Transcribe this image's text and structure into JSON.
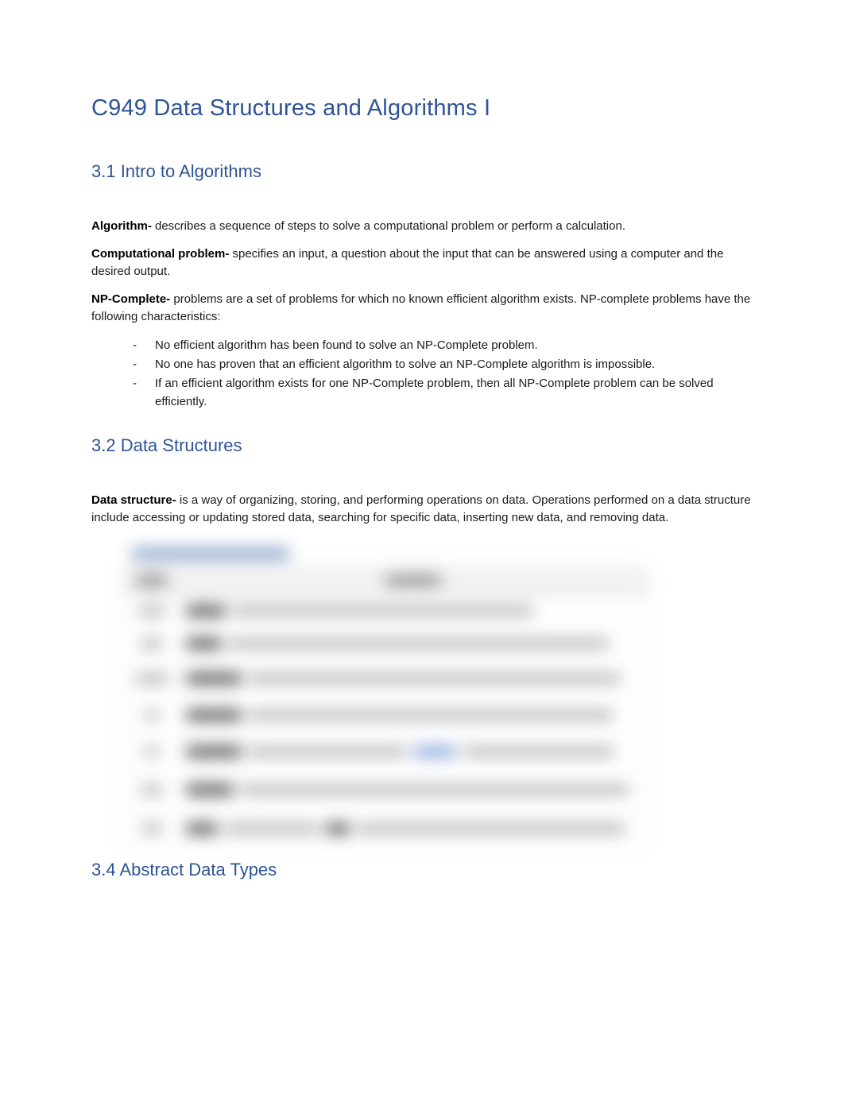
{
  "title": "C949 Data Structures and Algorithms I",
  "sections": {
    "s31": {
      "heading": "3.1 Intro to Algorithms",
      "p1_term": "Algorithm- ",
      "p1_body": "describes a sequence of steps to solve a computational problem or perform a calculation.",
      "p2_term": "Computational problem- ",
      "p2_body": "specifies an input, a question about the input that can be answered using a computer and the desired output.",
      "p3_term": "NP-Complete- ",
      "p3_body": "problems are a set of problems for which no known efficient algorithm exists. NP-complete problems have the following characteristics:",
      "bullets": [
        "No efficient algorithm has been found to solve an NP-Complete problem.",
        "No one has proven that an efficient algorithm to solve an NP-Complete algorithm is impossible.",
        "If an efficient algorithm exists for one NP-Complete problem, then all NP-Complete problem can be solved efficiently."
      ]
    },
    "s32": {
      "heading": "3.2 Data Structures",
      "p1_term": "Data structure- ",
      "p1_body": "is a way of organizing, storing, and performing operations on data. Operations performed on a data structure include accessing or updating stored data, searching for specific data, inserting new data, and removing data."
    },
    "s34": {
      "heading": "3.4 Abstract Data Types"
    }
  }
}
